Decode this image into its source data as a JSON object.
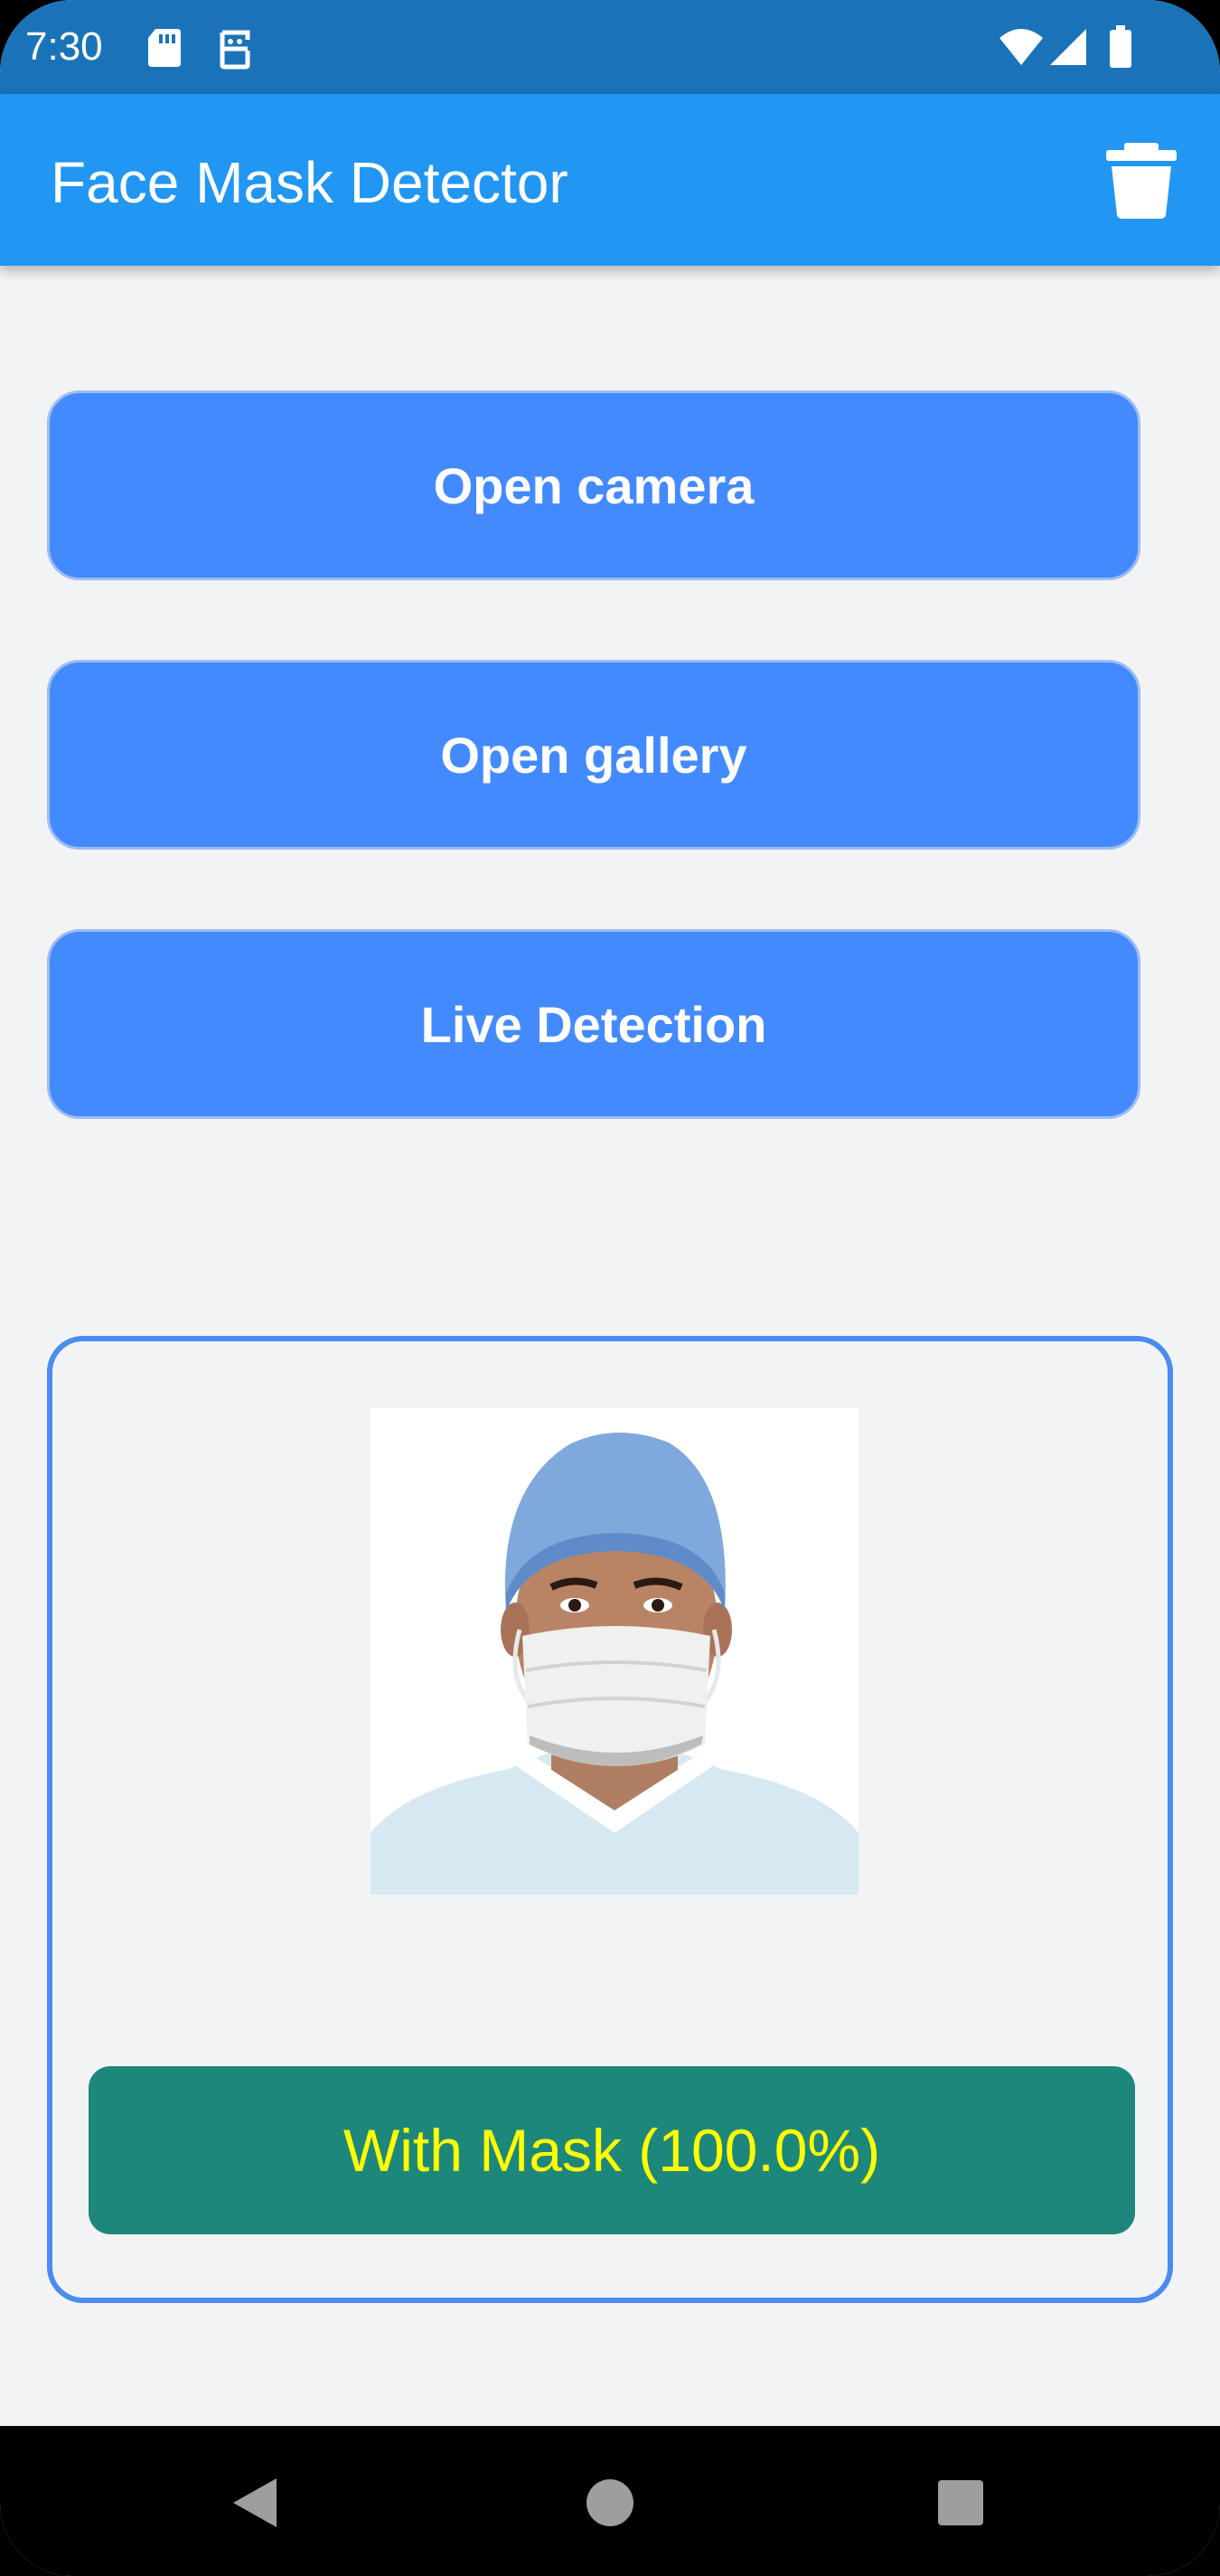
{
  "status_bar": {
    "time": "7:30",
    "icons": [
      "sd-card-icon",
      "sim-icon",
      "wifi-icon",
      "signal-icon",
      "battery-icon"
    ]
  },
  "app_bar": {
    "title": "Face Mask Detector",
    "delete_icon": "trash-icon"
  },
  "buttons": {
    "open_camera": "Open camera",
    "open_gallery": "Open gallery",
    "live_detection": "Live Detection"
  },
  "result": {
    "label": "With Mask (100.0%)",
    "label_color": "#ffff00",
    "label_bg": "#1e877c"
  },
  "nav_bar": {
    "icons": [
      "back-icon",
      "home-icon",
      "recents-icon"
    ]
  },
  "colors": {
    "status_bar": "#1a73b8",
    "app_bar": "#2196f3",
    "button": "#448aff",
    "card_border": "#4a8cf0",
    "background": "#f2f3f5"
  }
}
